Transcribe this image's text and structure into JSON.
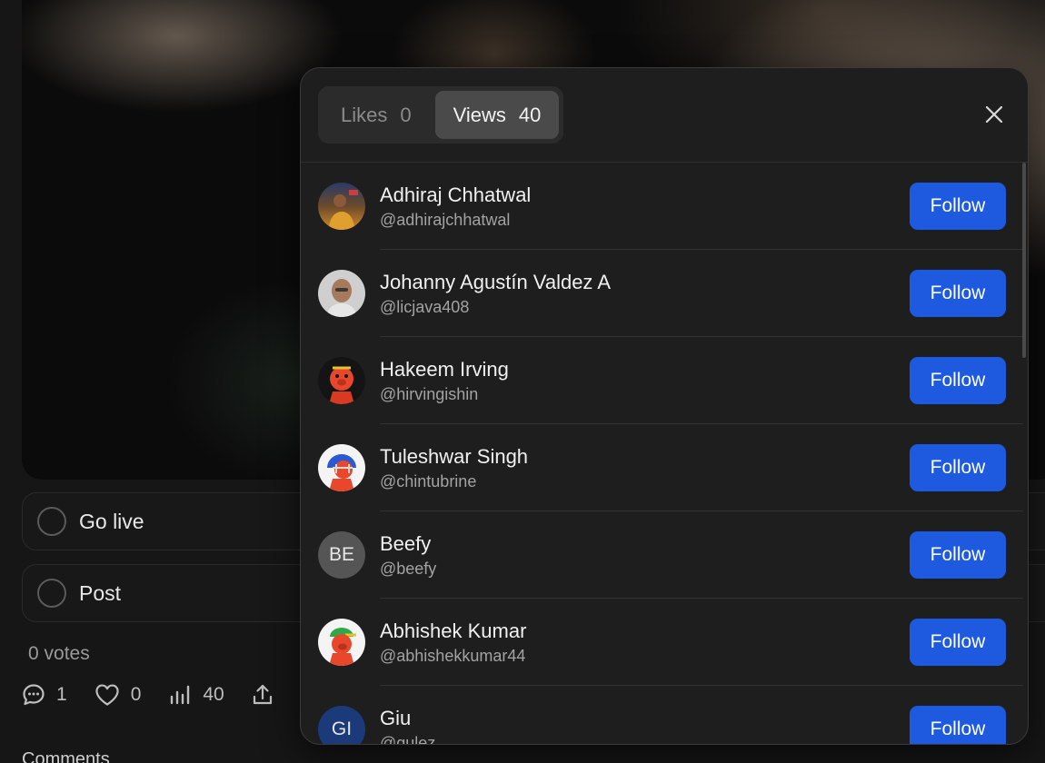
{
  "background": {
    "actions": [
      {
        "label": "Go live"
      },
      {
        "label": "Post"
      }
    ],
    "votes_text": "0 votes",
    "stats": {
      "comments": "1",
      "likes": "0",
      "views": "40"
    },
    "comments_heading": "Comments"
  },
  "modal": {
    "tabs": [
      {
        "label": "Likes",
        "count": "0",
        "active": false
      },
      {
        "label": "Views",
        "count": "40",
        "active": true
      }
    ],
    "follow_label": "Follow",
    "users": [
      {
        "name": "Adhiraj Chhatwal",
        "handle": "@adhirajchhatwal",
        "avatar": "photo"
      },
      {
        "name": "Johanny Agustín Valdez A",
        "handle": "@licjava408",
        "avatar": "photo"
      },
      {
        "name": "Hakeem Irving",
        "handle": "@hirvingishin",
        "avatar": "pig-mascot"
      },
      {
        "name": "Tuleshwar Singh",
        "handle": "@chintubrine",
        "avatar": "pig-helmet"
      },
      {
        "name": "Beefy",
        "handle": "@beefy",
        "avatar": "initials",
        "initials": "BE"
      },
      {
        "name": "Abhishek Kumar",
        "handle": "@abhishekkumar44",
        "avatar": "pig-cap"
      },
      {
        "name": "Giu",
        "handle": "@gulez",
        "avatar": "initials",
        "initials": "GI"
      }
    ]
  },
  "colors": {
    "follow_button": "#1d5ae0",
    "modal_bg": "#1e1e1e",
    "active_tab_bg": "#4a4a4a"
  }
}
